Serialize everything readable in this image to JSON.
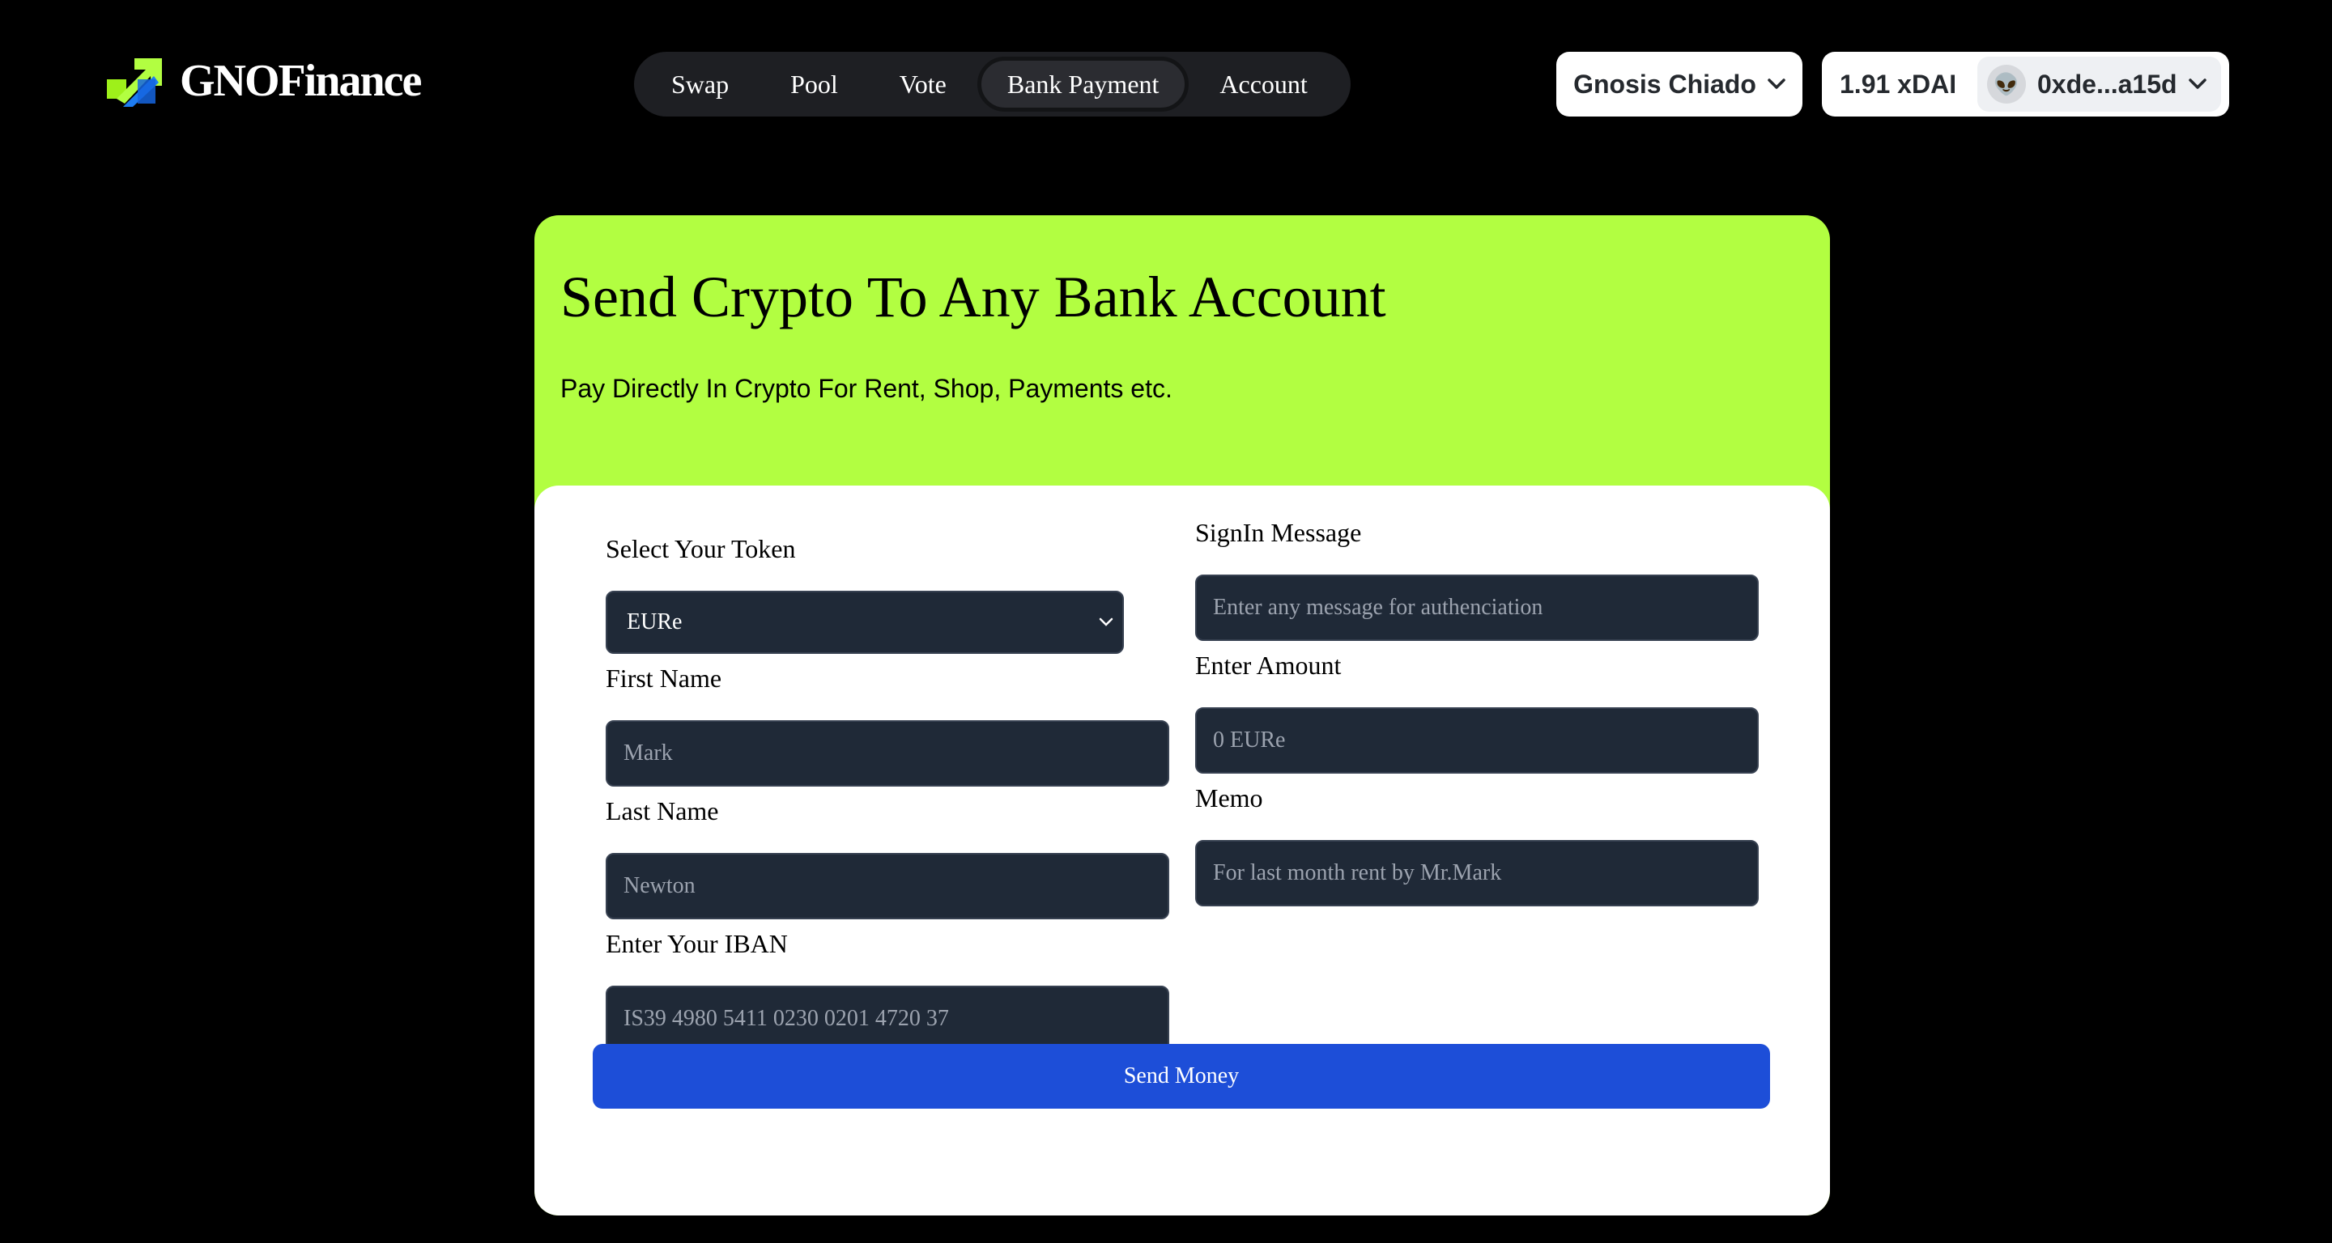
{
  "brand": {
    "name": "GNOFinance",
    "logo_icon": "arrow-logo-icon"
  },
  "nav": {
    "items": [
      {
        "label": "Swap"
      },
      {
        "label": "Pool"
      },
      {
        "label": "Vote"
      },
      {
        "label": "Bank Payment",
        "active": true
      },
      {
        "label": "Account"
      }
    ]
  },
  "wallet": {
    "chain": "Gnosis Chiado",
    "balance": "1.91 xDAI",
    "address": "0xde...a15d",
    "avatar_icon": "👽"
  },
  "hero": {
    "title": "Send Crypto To Any Bank Account",
    "subtitle": "Pay Directly In Crypto For Rent, Shop, Payments etc."
  },
  "form": {
    "token_label": "Select Your Token",
    "token_value": "EURe",
    "first_name_label": "First Name",
    "first_name_placeholder": "Mark",
    "last_name_label": "Last Name",
    "last_name_placeholder": "Newton",
    "iban_label": "Enter Your IBAN",
    "iban_placeholder": "IS39 4980 5411 0230 0201 4720 37",
    "signin_label": "SignIn Message",
    "signin_placeholder": "Enter any message for authenciation",
    "amount_label": "Enter Amount",
    "amount_placeholder": "0 EURe",
    "memo_label": "Memo",
    "memo_placeholder": "For last month rent by Mr.Mark",
    "submit_label": "Send Money"
  },
  "colors": {
    "background": "#000000",
    "accent_green": "#b2fe41",
    "input_bg": "#1f2937",
    "button_blue": "#1d4ed8"
  }
}
